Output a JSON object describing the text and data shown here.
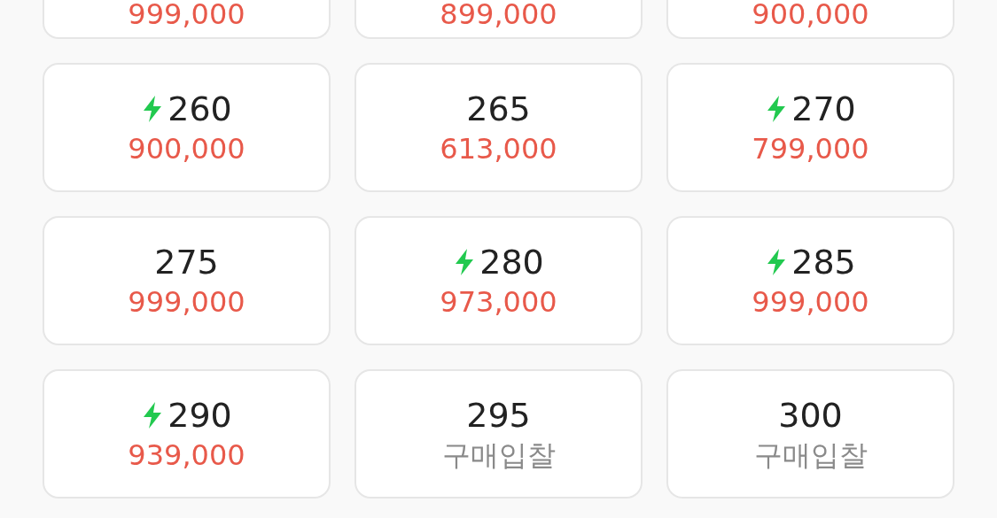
{
  "partial_row": [
    {
      "price": "999,000"
    },
    {
      "price": "899,000"
    },
    {
      "price": "900,000"
    }
  ],
  "options": [
    {
      "size": "260",
      "express": true,
      "kind": "price",
      "price": "900,000"
    },
    {
      "size": "265",
      "express": false,
      "kind": "price",
      "price": "613,000"
    },
    {
      "size": "270",
      "express": true,
      "kind": "price",
      "price": "799,000"
    },
    {
      "size": "275",
      "express": false,
      "kind": "price",
      "price": "999,000"
    },
    {
      "size": "280",
      "express": true,
      "kind": "price",
      "price": "973,000"
    },
    {
      "size": "285",
      "express": true,
      "kind": "price",
      "price": "999,000"
    },
    {
      "size": "290",
      "express": true,
      "kind": "price",
      "price": "939,000"
    },
    {
      "size": "295",
      "express": false,
      "kind": "bid",
      "price": "구매입찰"
    },
    {
      "size": "300",
      "express": false,
      "kind": "bid",
      "price": "구매입찰"
    }
  ]
}
